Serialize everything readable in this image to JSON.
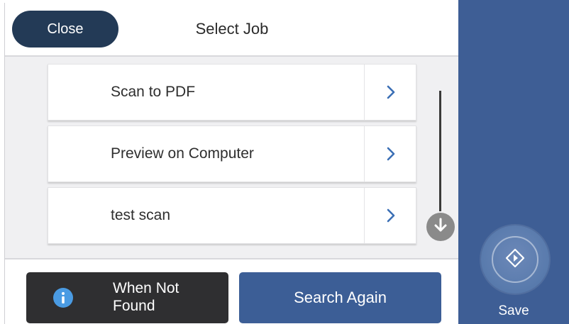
{
  "header": {
    "close_label": "Close",
    "title": "Select Job"
  },
  "jobs": [
    {
      "label": "Scan to PDF",
      "icon": "chevron-right-icon"
    },
    {
      "label": "Preview on Computer",
      "icon": "chevron-right-icon"
    },
    {
      "label": "test scan",
      "icon": "chevron-right-icon"
    }
  ],
  "footer": {
    "when_not_found_label": "When Not Found",
    "search_again_label": "Search Again"
  },
  "side_panel": {
    "save_label": "Save",
    "start_icon": "start-diamond-icon"
  },
  "colors": {
    "close_button": "#233a56",
    "side_panel": "#3e5e95",
    "search_again_button": "#3c5e96",
    "when_not_found_button": "#2f2f31",
    "chevron": "#3b6fb5",
    "info_icon": "#4a9be3"
  }
}
